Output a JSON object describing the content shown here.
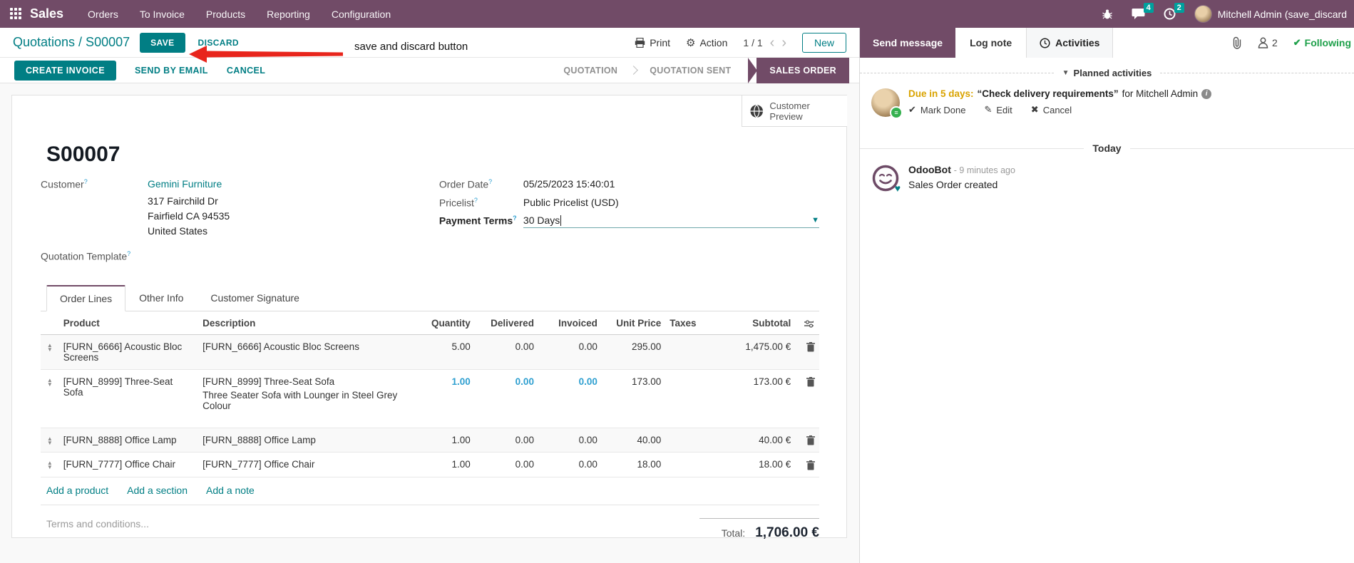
{
  "nav": {
    "app_name": "Sales",
    "menus": [
      "Orders",
      "To Invoice",
      "Products",
      "Reporting",
      "Configuration"
    ],
    "messages_badge": "4",
    "activities_badge": "2",
    "user_name": "Mitchell Admin (save_discard",
    "colors": {
      "bg": "#714B67",
      "badge": "#00A09D"
    }
  },
  "control_panel": {
    "breadcrumb": "Quotations / S00007",
    "save_label": "SAVE",
    "discard_label": "DISCARD",
    "annotation": "save and discard button",
    "print_label": "Print",
    "action_label": "Action",
    "pager": "1 / 1",
    "new_label": "New"
  },
  "statusbar": {
    "buttons": [
      "CREATE INVOICE",
      "SEND BY EMAIL",
      "CANCEL"
    ],
    "states": [
      {
        "label": "QUOTATION",
        "active": false
      },
      {
        "label": "QUOTATION SENT",
        "active": false
      },
      {
        "label": "SALES ORDER",
        "active": true
      }
    ]
  },
  "sheet": {
    "customer_preview_label": "Customer Preview",
    "title": "S00007",
    "fields": {
      "customer_label": "Customer",
      "customer_name": "Gemini Furniture",
      "address": [
        "317 Fairchild Dr",
        "Fairfield CA 94535",
        "United States"
      ],
      "quotation_template_label": "Quotation Template",
      "order_date_label": "Order Date",
      "order_date": "05/25/2023 15:40:01",
      "pricelist_label": "Pricelist",
      "pricelist": "Public Pricelist (USD)",
      "payment_terms_label": "Payment Terms",
      "payment_terms": "30 Days"
    },
    "tabs": [
      "Order Lines",
      "Other Info",
      "Customer Signature"
    ],
    "table": {
      "columns": [
        "Product",
        "Description",
        "Quantity",
        "Delivered",
        "Invoiced",
        "Unit Price",
        "Taxes",
        "Subtotal"
      ],
      "rows": [
        {
          "product": "[FURN_6666] Acoustic Bloc Screens",
          "description": "[FURN_6666] Acoustic Bloc Screens",
          "description2": "",
          "quantity": "5.00",
          "delivered": "0.00",
          "invoiced": "0.00",
          "unit_price": "295.00",
          "taxes": "",
          "subtotal": "1,475.00 €",
          "modified": false
        },
        {
          "product": "[FURN_8999] Three-Seat Sofa",
          "description": "[FURN_8999] Three-Seat Sofa",
          "description2": "Three Seater Sofa with Lounger in Steel Grey Colour",
          "quantity": "1.00",
          "delivered": "0.00",
          "invoiced": "0.00",
          "unit_price": "173.00",
          "taxes": "",
          "subtotal": "173.00 €",
          "modified": true
        },
        {
          "product": "[FURN_8888] Office Lamp",
          "description": "[FURN_8888] Office Lamp",
          "description2": "",
          "quantity": "1.00",
          "delivered": "0.00",
          "invoiced": "0.00",
          "unit_price": "40.00",
          "taxes": "",
          "subtotal": "40.00 €",
          "modified": false
        },
        {
          "product": "[FURN_7777] Office Chair",
          "description": "[FURN_7777] Office Chair",
          "description2": "",
          "quantity": "1.00",
          "delivered": "0.00",
          "invoiced": "0.00",
          "unit_price": "18.00",
          "taxes": "",
          "subtotal": "18.00 €",
          "modified": false
        }
      ],
      "footer_links": [
        "Add a product",
        "Add a section",
        "Add a note"
      ]
    },
    "terms_placeholder": "Terms and conditions...",
    "total_label": "Total:",
    "total_value": "1,706.00 €"
  },
  "chatter": {
    "send_message_label": "Send message",
    "log_note_label": "Log note",
    "activities_label": "Activities",
    "followers_count": "2",
    "following_label": "Following",
    "planned_header": "Planned activities",
    "activity": {
      "due": "Due in 5 days:",
      "summary": "“Check delivery requirements”",
      "for_text": "for Mitchell Admin",
      "mark_done": "Mark Done",
      "edit": "Edit",
      "cancel": "Cancel"
    },
    "today_label": "Today",
    "message": {
      "author": "OdooBot",
      "time": "- 9 minutes ago",
      "body": "Sales Order created"
    }
  },
  "colors": {
    "brand_purple": "#714B67",
    "accent_teal": "#017e84",
    "modified_blue": "#2e9fd0",
    "due_orange": "#d9a300",
    "following_green": "#1ea04a",
    "arrow_red": "#e8251c"
  }
}
